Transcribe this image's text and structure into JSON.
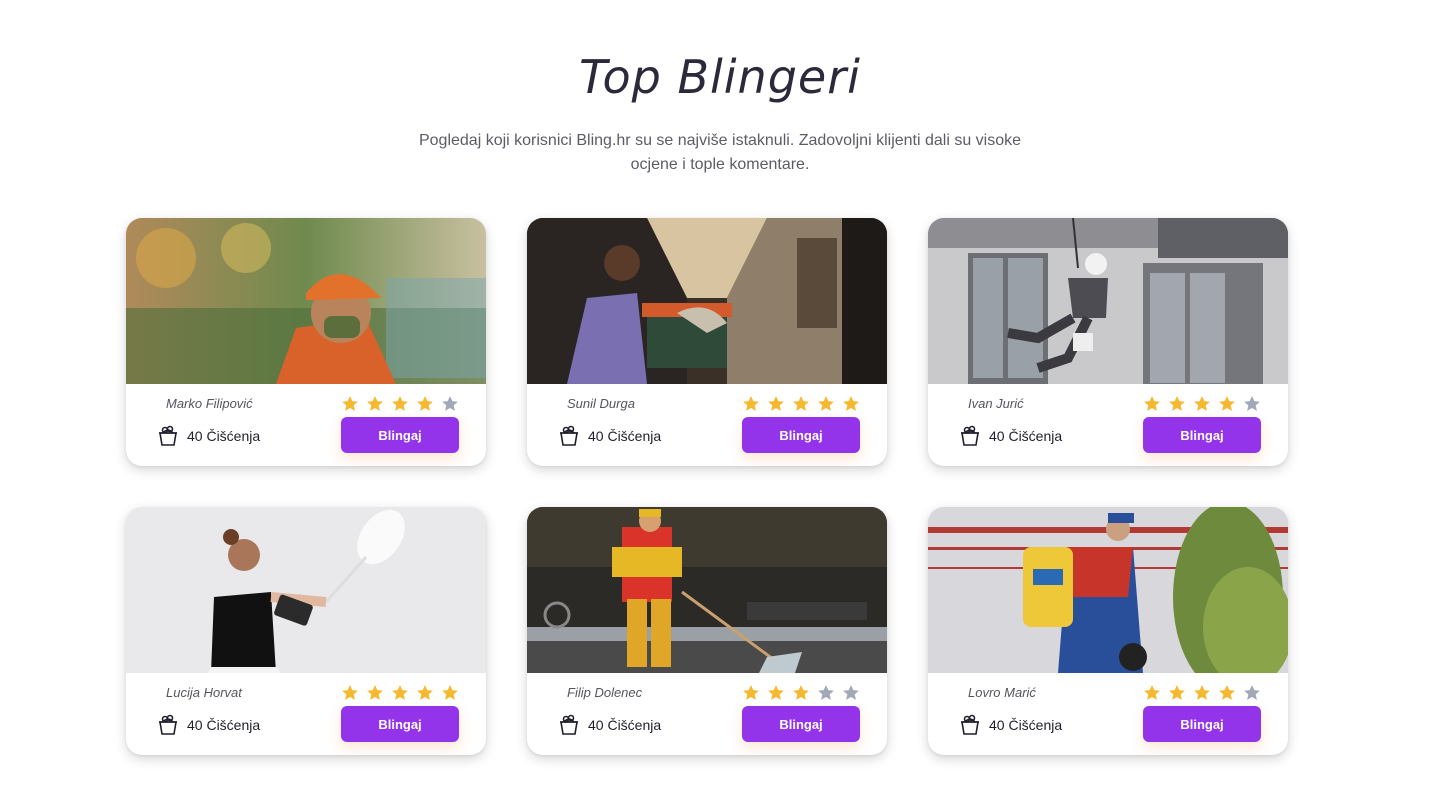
{
  "section": {
    "title": "Top Blingeri",
    "subtitle": "Pogledaj koji korisnici Bling.hr su se najviše istaknuli. Zadovoljni klijenti dali su visoke ocjene i tople komentare."
  },
  "colors": {
    "accent": "#9333ea",
    "star_filled": "#f5b82e",
    "star_empty": "#a3a8b8"
  },
  "cards": [
    {
      "name": "Marko Filipović",
      "rating": 4,
      "cleanings": "40 Čišćenja",
      "button": "Blingaj",
      "photo_icon": "worker-orange-cap-photo"
    },
    {
      "name": "Sunil Durga",
      "rating": 5,
      "cleanings": "40 Čišćenja",
      "button": "Blingaj",
      "photo_icon": "hotel-corridor-cart-photo"
    },
    {
      "name": "Ivan Jurić",
      "rating": 4,
      "cleanings": "40 Čišćenja",
      "button": "Blingaj",
      "photo_icon": "rope-window-cleaner-photo"
    },
    {
      "name": "Lucija Horvat",
      "rating": 5,
      "cleanings": "40 Čišćenja",
      "button": "Blingaj",
      "photo_icon": "woman-duster-photo"
    },
    {
      "name": "Filip Dolenec",
      "rating": 3,
      "cleanings": "40 Čišćenja",
      "button": "Blingaj",
      "photo_icon": "street-sweeper-photo"
    },
    {
      "name": "Lovro Marić",
      "rating": 4,
      "cleanings": "40 Čišćenja",
      "button": "Blingaj",
      "photo_icon": "sprayer-worker-photo"
    }
  ]
}
